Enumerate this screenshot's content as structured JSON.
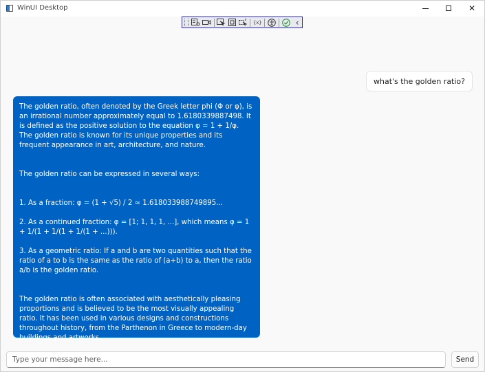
{
  "window": {
    "title": "WinUI Desktop",
    "minimize_glyph": "—",
    "close_glyph": "✕"
  },
  "debug_toolbar": {
    "tools": [
      {
        "icon": "live-tree-icon"
      },
      {
        "icon": "video-camera-icon"
      },
      {
        "icon": "select-element-icon"
      },
      {
        "icon": "display-layout-adorners-icon"
      },
      {
        "icon": "track-focus-icon"
      },
      {
        "icon": "binding-failures-icon"
      },
      {
        "icon": "accessibility-icon"
      },
      {
        "icon": "checkmark-icon"
      },
      {
        "icon": "collapse-chevron-icon"
      }
    ],
    "binding_glyph": "{x}",
    "collapse_glyph": "‹",
    "colors": {
      "border": "#2d2d8f",
      "accent_check": "#1e8f2e"
    }
  },
  "chat": {
    "user_message": "what's the golden ratio?",
    "assistant_paragraphs": [
      "The golden ratio, often denoted by the Greek letter phi (Φ or φ), is an irrational number approximately equal to 1.6180339887498. It is defined as the positive solution to the equation φ = 1 + 1/φ. The golden ratio is known for its unique properties and its frequent appearance in art, architecture, and nature.",
      "The golden ratio can be expressed in several ways:",
      "1. As a fraction: φ = (1 + √5) / 2 ≈ 1.618033988749895...",
      "2. As a continued fraction: φ = [1; 1, 1, 1, ...], which means φ = 1 + 1/(1 + 1/(1 + 1/(1 + ...))).",
      "3. As a geometric ratio: If a and b are two quantities such that the ratio of a to b is the same as the ratio of (a+b) to a, then the ratio a/b is the golden ratio.",
      "The golden ratio is often associated with aesthetically pleasing proportions and is believed to be the most visually appealing ratio. It has been used in various designs and constructions throughout history, from the Parthenon in Greece to modern-day buildings and artworks."
    ],
    "colors": {
      "assistant_bubble": "#0063c3",
      "user_bubble": "#ffffff"
    }
  },
  "composer": {
    "placeholder": "Type your message here...",
    "value": "",
    "send_label": "Send"
  }
}
